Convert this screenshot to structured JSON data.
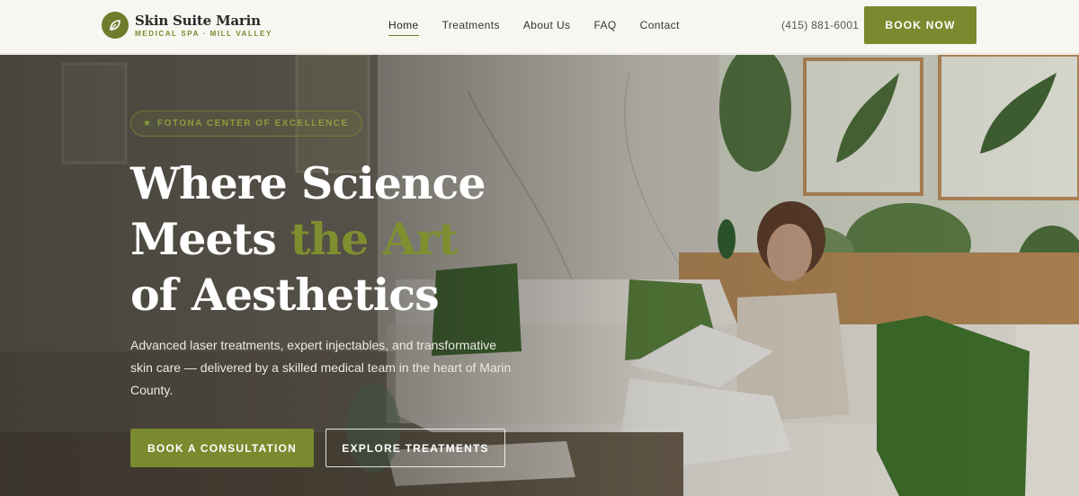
{
  "brand": {
    "name": "Skin Suite Marin",
    "tagline": "MEDICAL SPA · MILL VALLEY",
    "logo_icon": "leaf-icon"
  },
  "nav": {
    "items": [
      {
        "label": "Home",
        "active": true
      },
      {
        "label": "Treatments",
        "active": false
      },
      {
        "label": "About Us",
        "active": false
      },
      {
        "label": "FAQ",
        "active": false
      },
      {
        "label": "Contact",
        "active": false
      }
    ],
    "phone": "(415) 881-6001",
    "cta": "BOOK NOW"
  },
  "hero": {
    "badge": "FOTONA CENTER OF EXCELLENCE",
    "badge_icon": "star-icon",
    "headline_line1": "Where Science",
    "headline_line2_start": "Meets ",
    "headline_line2_accent": "the Art",
    "headline_line3": "of Aesthetics",
    "subtext": "Advanced laser treatments, expert injectables, and transformative skin care — delivered by a skilled medical team in the heart of Marin County.",
    "primary_cta": "BOOK A CONSULTATION",
    "secondary_cta": "EXPLORE TREATMENTS"
  },
  "colors": {
    "brand_green": "#7a8a2e",
    "nav_background": "#f8f6f1",
    "headline_white": "#ffffff"
  }
}
